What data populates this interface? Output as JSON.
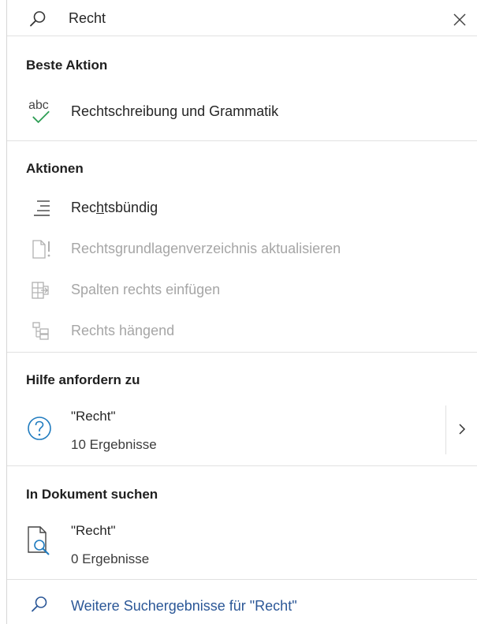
{
  "search": {
    "value": "Recht",
    "icon": "search-icon",
    "close_icon": "close-icon"
  },
  "best_action": {
    "header": "Beste Aktion",
    "item": {
      "label": "Rechtschreibung und Grammatik",
      "icon": "spelling-grammar-icon"
    }
  },
  "actions": {
    "header": "Aktionen",
    "items": [
      {
        "label_pre": "Rec",
        "label_underline": "h",
        "label_post": "tsbündig",
        "icon": "align-right-icon",
        "enabled": true
      },
      {
        "label": "Rechtsgrundlagenverzeichnis aktualisieren",
        "icon": "document-update-icon",
        "enabled": false
      },
      {
        "label": "Spalten rechts einfügen",
        "icon": "insert-column-right-icon",
        "enabled": false
      },
      {
        "label": "Rechts hängend",
        "icon": "org-chart-right-hanging-icon",
        "enabled": false
      }
    ]
  },
  "help": {
    "header": "Hilfe anfordern zu",
    "title": "\"Recht\"",
    "subtitle": "10 Ergebnisse",
    "icon": "help-icon",
    "chevron_icon": "chevron-right-icon"
  },
  "document_search": {
    "header": "In Dokument suchen",
    "title": "\"Recht\"",
    "subtitle": "0 Ergebnisse",
    "icon": "document-search-icon"
  },
  "more_results": {
    "label": "Weitere Suchergebnisse für \"Recht\"",
    "icon": "search-icon"
  },
  "colors": {
    "accent_blue": "#2b5797",
    "help_blue": "#1f7bbf",
    "check_green": "#2e9e55",
    "disabled_text": "#a6a6a6"
  }
}
